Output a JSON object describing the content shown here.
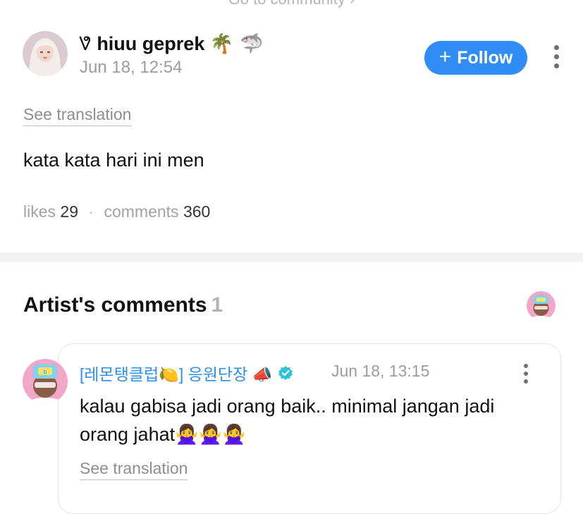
{
  "top_link": "Go to community ›",
  "post": {
    "author_prefix": "𖬀",
    "author_name": "hiuu geprek",
    "author_emoji": "🌴 🦈",
    "date": "Jun 18, 12:54",
    "follow_label": "Follow",
    "follow_icon": "+",
    "see_translation": "See translation",
    "body": "kata kata hari ini men",
    "likes_label": "likes",
    "likes_count": "29",
    "comments_label": "comments",
    "comments_count": "360"
  },
  "artist_section": {
    "title": "Artist's comments",
    "count": "1"
  },
  "comment": {
    "author": "[레몬탱클럽🍋] 응원단장 📣",
    "date": "Jun 18, 13:15",
    "body": "kalau gabisa jadi orang baik.. minimal jangan jadi orang jahat🙅‍♀️🙅‍♀️🙅‍♀️",
    "see_translation": "See translation"
  },
  "icons": {
    "kebab": "more-vertical-icon",
    "verified": "verified-badge-icon"
  },
  "colors": {
    "accent": "#2f8df5",
    "artist_blue": "#2d8ff0",
    "verified": "#2ec4d6",
    "muted": "#9c9c9c"
  }
}
